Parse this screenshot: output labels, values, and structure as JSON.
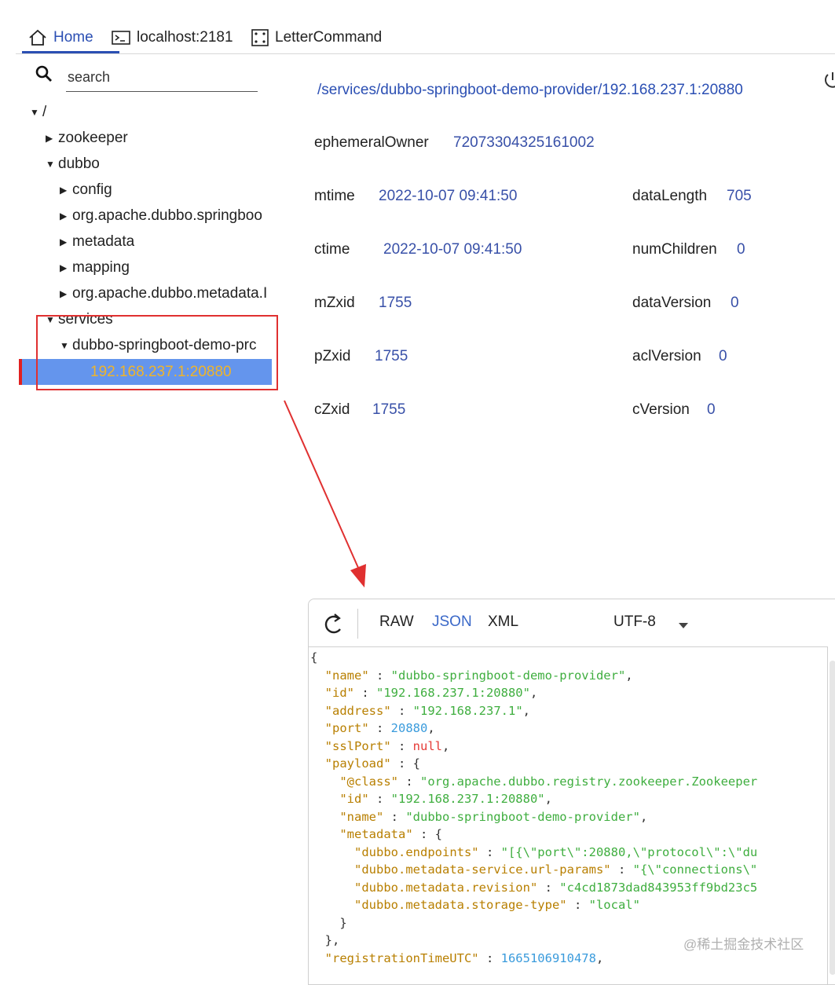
{
  "tabs": [
    {
      "label": "Home"
    },
    {
      "label": "localhost:2181"
    },
    {
      "label": "LetterCommand"
    }
  ],
  "search": {
    "placeholder": "search"
  },
  "tree": {
    "root": "/",
    "zookeeper": "zookeeper",
    "dubbo": "dubbo",
    "config": "config",
    "springboot": "org.apache.dubbo.springboo",
    "metadata": "metadata",
    "mapping": "mapping",
    "metadata_pkg": "org.apache.dubbo.metadata.I",
    "services": "services",
    "provider": "dubbo-springboot-demo-prc",
    "selected": "192.168.237.1:20880"
  },
  "details": {
    "path": "/services/dubbo-springboot-demo-provider/192.168.237.1:20880",
    "ephemeralOwner_label": "ephemeralOwner",
    "ephemeralOwner": "72073304325161002",
    "mtime_label": "mtime",
    "mtime": "2022-10-07 09:41:50",
    "ctime_label": "ctime",
    "ctime": "2022-10-07 09:41:50",
    "mZxid_label": "mZxid",
    "mZxid": "1755",
    "pZxid_label": "pZxid",
    "pZxid": "1755",
    "cZxid_label": "cZxid",
    "cZxid": "1755",
    "dataLength_label": "dataLength",
    "dataLength": "705",
    "numChildren_label": "numChildren",
    "numChildren": "0",
    "dataVersion_label": "dataVersion",
    "dataVersion": "0",
    "aclVersion_label": "aclVersion",
    "aclVersion": "0",
    "cVersion_label": "cVersion",
    "cVersion": "0"
  },
  "editor": {
    "raw": "RAW",
    "json": "JSON",
    "xml": "XML",
    "encoding": "UTF-8",
    "code_lines": [
      [
        {
          "t": "p",
          "v": "{"
        }
      ],
      [
        {
          "t": "p",
          "v": "  "
        },
        {
          "t": "k",
          "v": "\"name\""
        },
        {
          "t": "p",
          "v": " : "
        },
        {
          "t": "s",
          "v": "\"dubbo-springboot-demo-provider\""
        },
        {
          "t": "p",
          "v": ","
        }
      ],
      [
        {
          "t": "p",
          "v": "  "
        },
        {
          "t": "k",
          "v": "\"id\""
        },
        {
          "t": "p",
          "v": " : "
        },
        {
          "t": "s",
          "v": "\"192.168.237.1:20880\""
        },
        {
          "t": "p",
          "v": ","
        }
      ],
      [
        {
          "t": "p",
          "v": "  "
        },
        {
          "t": "k",
          "v": "\"address\""
        },
        {
          "t": "p",
          "v": " : "
        },
        {
          "t": "s",
          "v": "\"192.168.237.1\""
        },
        {
          "t": "p",
          "v": ","
        }
      ],
      [
        {
          "t": "p",
          "v": "  "
        },
        {
          "t": "k",
          "v": "\"port\""
        },
        {
          "t": "p",
          "v": " : "
        },
        {
          "t": "n",
          "v": "20880"
        },
        {
          "t": "p",
          "v": ","
        }
      ],
      [
        {
          "t": "p",
          "v": "  "
        },
        {
          "t": "k",
          "v": "\"sslPort\""
        },
        {
          "t": "p",
          "v": " : "
        },
        {
          "t": "nl",
          "v": "null"
        },
        {
          "t": "p",
          "v": ","
        }
      ],
      [
        {
          "t": "p",
          "v": "  "
        },
        {
          "t": "k",
          "v": "\"payload\""
        },
        {
          "t": "p",
          "v": " : {"
        }
      ],
      [
        {
          "t": "p",
          "v": "    "
        },
        {
          "t": "k",
          "v": "\"@class\""
        },
        {
          "t": "p",
          "v": " : "
        },
        {
          "t": "s",
          "v": "\"org.apache.dubbo.registry.zookeeper.Zookeeper"
        }
      ],
      [
        {
          "t": "p",
          "v": "    "
        },
        {
          "t": "k",
          "v": "\"id\""
        },
        {
          "t": "p",
          "v": " : "
        },
        {
          "t": "s",
          "v": "\"192.168.237.1:20880\""
        },
        {
          "t": "p",
          "v": ","
        }
      ],
      [
        {
          "t": "p",
          "v": "    "
        },
        {
          "t": "k",
          "v": "\"name\""
        },
        {
          "t": "p",
          "v": " : "
        },
        {
          "t": "s",
          "v": "\"dubbo-springboot-demo-provider\""
        },
        {
          "t": "p",
          "v": ","
        }
      ],
      [
        {
          "t": "p",
          "v": "    "
        },
        {
          "t": "k",
          "v": "\"metadata\""
        },
        {
          "t": "p",
          "v": " : {"
        }
      ],
      [
        {
          "t": "p",
          "v": "      "
        },
        {
          "t": "k",
          "v": "\"dubbo.endpoints\""
        },
        {
          "t": "p",
          "v": " : "
        },
        {
          "t": "s",
          "v": "\"[{\\\"port\\\":20880,\\\"protocol\\\":\\\"du"
        }
      ],
      [
        {
          "t": "p",
          "v": "      "
        },
        {
          "t": "k",
          "v": "\"dubbo.metadata-service.url-params\""
        },
        {
          "t": "p",
          "v": " : "
        },
        {
          "t": "s",
          "v": "\"{\\\"connections\\\""
        }
      ],
      [
        {
          "t": "p",
          "v": "      "
        },
        {
          "t": "k",
          "v": "\"dubbo.metadata.revision\""
        },
        {
          "t": "p",
          "v": " : "
        },
        {
          "t": "s",
          "v": "\"c4cd1873dad843953ff9bd23c5"
        }
      ],
      [
        {
          "t": "p",
          "v": "      "
        },
        {
          "t": "k",
          "v": "\"dubbo.metadata.storage-type\""
        },
        {
          "t": "p",
          "v": " : "
        },
        {
          "t": "s",
          "v": "\"local\""
        }
      ],
      [
        {
          "t": "p",
          "v": "    }"
        }
      ],
      [
        {
          "t": "p",
          "v": "  },"
        }
      ],
      [
        {
          "t": "p",
          "v": "  "
        },
        {
          "t": "k",
          "v": "\"registrationTimeUTC\""
        },
        {
          "t": "p",
          "v": " : "
        },
        {
          "t": "n",
          "v": "1665106910478"
        },
        {
          "t": "p",
          "v": ","
        }
      ]
    ]
  },
  "watermark": "@稀土掘金技术社区"
}
